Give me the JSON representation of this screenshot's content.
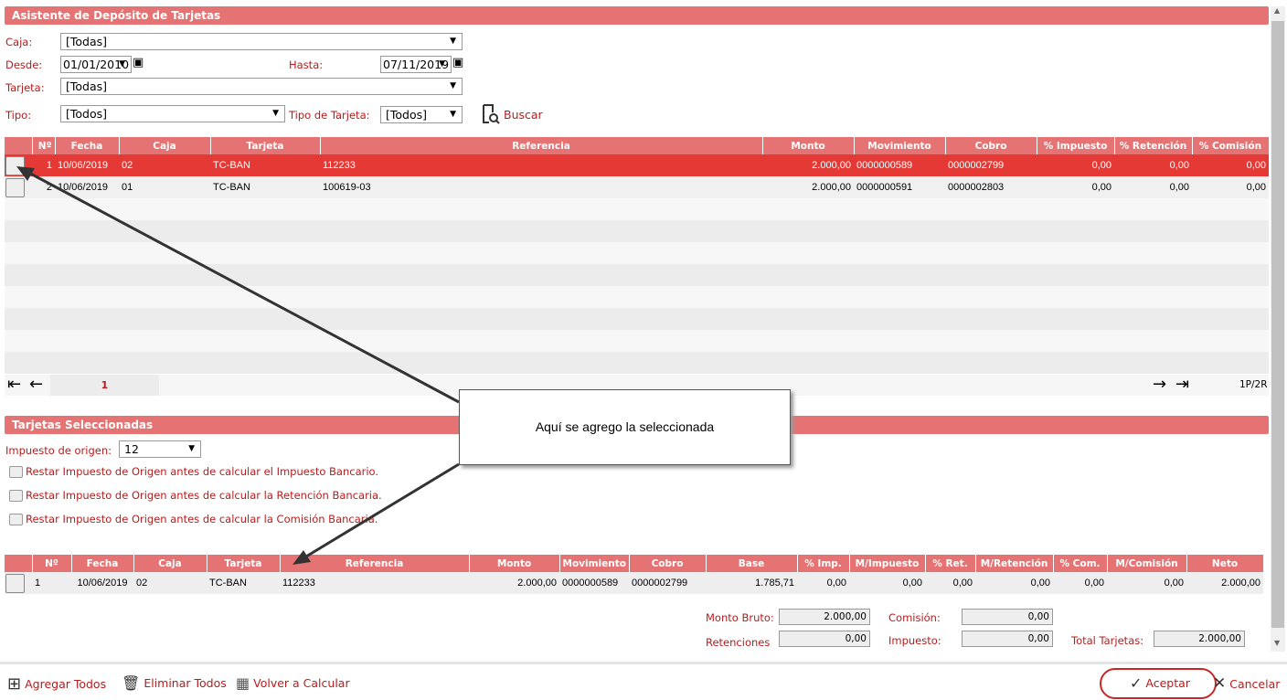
{
  "title": "Asistente de Depósito de Tarjetas",
  "filters": {
    "caja_label": "Caja:",
    "caja_value": "[Todas]",
    "desde_label": "Desde:",
    "desde_value": "01/01/2010",
    "hasta_label": "Hasta:",
    "hasta_value": "07/11/2019",
    "tarjeta_label": "Tarjeta:",
    "tarjeta_value": "[Todas]",
    "tipo_label": "Tipo:",
    "tipo_value": "[Todos]",
    "tipo_tarjeta_label": "Tipo de Tarjeta:",
    "tipo_tarjeta_value": "[Todos]",
    "buscar": "Buscar"
  },
  "grid": {
    "columns": [
      "",
      "Nº",
      "Fecha",
      "Caja",
      "Tarjeta",
      "Referencia",
      "Monto",
      "Movimiento",
      "Cobro",
      "% Impuesto",
      "% Retención",
      "% Comisión"
    ],
    "rows": [
      [
        "",
        "1",
        "10/06/2019",
        "02",
        "TC-BAN",
        "112233",
        "2.000,00",
        "0000000589",
        "0000002799",
        "0,00",
        "0,00",
        "0,00"
      ],
      [
        "",
        "2",
        "10/06/2019",
        "01",
        "TC-BAN",
        "100619-03",
        "2.000,00",
        "0000000591",
        "0000002803",
        "0,00",
        "0,00",
        "0,00"
      ]
    ],
    "selected_row": 0,
    "page": "1",
    "page_info": "1P/2R"
  },
  "selected": {
    "title": "Tarjetas Seleccionadas",
    "impuesto_label": "Impuesto de origen:",
    "impuesto_value": "12",
    "checks": [
      "Restar Impuesto de Origen antes de calcular el Impuesto Bancario.",
      "Restar Impuesto de Origen antes de calcular la Retención Bancaria.",
      "Restar Impuesto de Origen antes de calcular la Comisión Bancaria."
    ],
    "columns": [
      "",
      "Nº",
      "Fecha",
      "Caja",
      "Tarjeta",
      "Referencia",
      "Monto",
      "Movimiento",
      "Cobro",
      "Base",
      "% Imp.",
      "M/Impuesto",
      "% Ret.",
      "M/Retención",
      "% Com.",
      "M/Comisión",
      "Neto"
    ],
    "rows": [
      [
        "",
        "1",
        "10/06/2019",
        "02",
        "TC-BAN",
        "112233",
        "2.000,00",
        "0000000589",
        "0000002799",
        "1.785,71",
        "0,00",
        "0,00",
        "0,00",
        "0,00",
        "0,00",
        "0,00",
        "2.000,00"
      ]
    ]
  },
  "totals": {
    "monto_bruto_label": "Monto Bruto:",
    "monto_bruto": "2.000,00",
    "comision_label": "Comisión:",
    "comision": "0,00",
    "retenciones_label": "Retenciones",
    "retenciones": "0,00",
    "impuesto_label": "Impuesto:",
    "impuesto": "0,00",
    "total_label": "Total Tarjetas:",
    "total": "2.000,00"
  },
  "toolbar": {
    "agregar": "Agregar Todos",
    "eliminar": "Eliminar Todos",
    "recalcular": "Volver a Calcular",
    "aceptar": "Aceptar",
    "cancelar": "Cancelar"
  },
  "annotation": "Aquí se agrego la seleccionada",
  "colors": {
    "header": "#e57373",
    "selected_row": "#e53935",
    "label": "#b71c1c"
  }
}
